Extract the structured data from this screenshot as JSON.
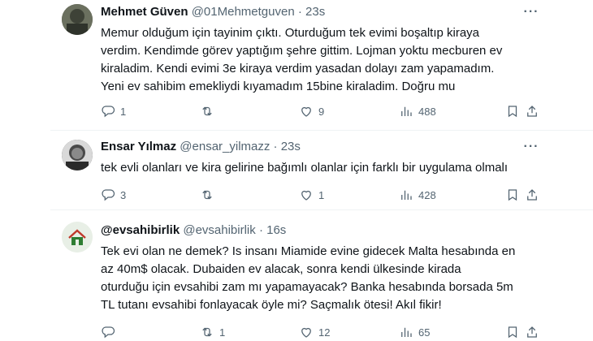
{
  "tweets": [
    {
      "name": "Mehmet Güven",
      "handle": "@01Mehmetguven",
      "sep": "·",
      "time": "23s",
      "more_icon": "more-icon",
      "text": "Memur olduğum için tayinim çıktı. Oturduğum tek evimi boşaltıp kiraya\nverdim. Kendimde görev yaptığım şehre gittim. Lojman yoktu mecburen ev\nkiraladim. Kendi evimi 3e kiraya verdim yasadan dolayı zam yapamadım.\nYeni ev sahibim emekliydi kıyamadım 15bine kiraladim. Doğru mu",
      "reply_count": "1",
      "retweet_count": "",
      "like_count": "9",
      "view_count": "488",
      "avatar_color": "#5a6150"
    },
    {
      "name": "Ensar Yılmaz",
      "handle": "@ensar_yilmazz",
      "sep": "·",
      "time": "23s",
      "text": "tek evli olanları ve kira gelirine bağımlı olanlar için farklı bir uygulama olmalı",
      "reply_count": "3",
      "retweet_count": "",
      "like_count": "1",
      "view_count": "428",
      "avatar_color": "#3c3c3c"
    },
    {
      "name": "@evsahibirlik",
      "handle": "@evsahibirlik",
      "sep": "·",
      "time": "16s",
      "text": "Tek evi olan ne demek? Is insanı Miamide evine gidecek Malta hesabında en\naz 40m$ olacak. Dubaiden ev alacak, sonra kendi ülkesinde kirada\noturduğu için evsahibi zam mı yapamayacak? Banka hesabında borsada 5m\nTL tutanı evsahibi fonlayacak öyle mi? Saçmalık ötesi! Akıl fikir!",
      "reply_count": "",
      "retweet_count": "1",
      "like_count": "12",
      "view_count": "65",
      "avatar_color": "#e8efe6"
    }
  ],
  "icons": {
    "reply": "reply-icon",
    "retweet": "retweet-icon",
    "like": "heart-icon",
    "views": "views-icon",
    "bookmark": "bookmark-icon",
    "share": "share-icon"
  }
}
